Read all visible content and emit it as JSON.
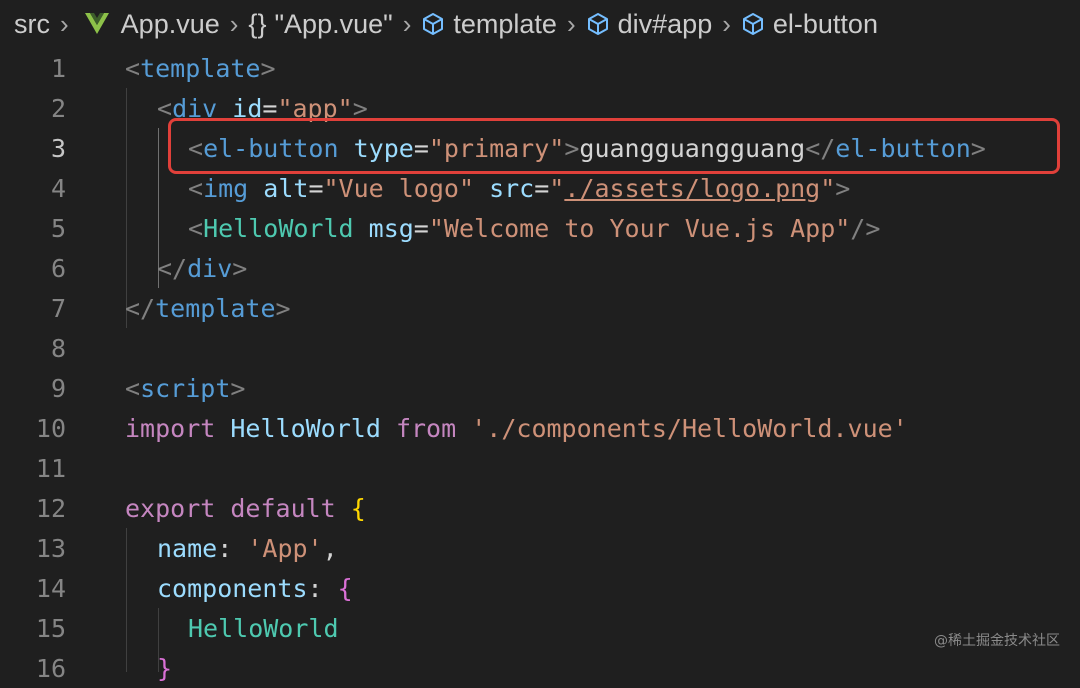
{
  "breadcrumb": {
    "items": [
      "src",
      "App.vue",
      "\"App.vue\"",
      "template",
      "div#app",
      "el-button"
    ],
    "separator": ">",
    "braces": "{}"
  },
  "editor": {
    "line_numbers": [
      "1",
      "2",
      "3",
      "4",
      "5",
      "6",
      "7",
      "8",
      "9",
      "10",
      "11",
      "12",
      "13",
      "14",
      "15",
      "16"
    ],
    "active_line": "3",
    "lines": {
      "l1": {
        "open": "<",
        "tag": "template",
        "close": ">"
      },
      "l2": {
        "open": "<",
        "tag": "div",
        "attr": "id",
        "eq": "=",
        "val": "\"app\"",
        "close": ">"
      },
      "l3": {
        "open": "<",
        "tag": "el-button",
        "attr": "type",
        "eq": "=",
        "val": "\"primary\"",
        "close": ">",
        "text": "guangguangguang",
        "end_open": "</",
        "end_tag": "el-button",
        "end_close": ">"
      },
      "l4": {
        "open": "<",
        "tag": "img",
        "attr1": "alt",
        "eq": "=",
        "val1": "\"Vue logo\"",
        "attr2": "src",
        "q1": "\"",
        "val2": "./assets/logo.png",
        "q2": "\"",
        "close": ">"
      },
      "l5": {
        "open": "<",
        "tag": "HelloWorld",
        "attr": "msg",
        "eq": "=",
        "val": "\"Welcome to Your Vue.js App\"",
        "close": "/>"
      },
      "l6": {
        "open": "</",
        "tag": "div",
        "close": ">"
      },
      "l7": {
        "open": "</",
        "tag": "template",
        "close": ">"
      },
      "l9": {
        "open": "<",
        "tag": "script",
        "close": ">"
      },
      "l10": {
        "kw1": "import",
        "id": "HelloWorld",
        "kw2": "from",
        "str": "'./components/HelloWorld.vue'"
      },
      "l12": {
        "kw1": "export",
        "kw2": "default",
        "brace": "{"
      },
      "l13": {
        "key": "name",
        "colon": ":",
        "str": "'App'",
        "comma": ","
      },
      "l14": {
        "key": "components",
        "colon": ":",
        "brace": "{"
      },
      "l15": {
        "id": "HelloWorld"
      },
      "l16": {
        "brace": "}"
      }
    }
  },
  "watermark": "@稀土掘金技术社区",
  "colors": {
    "background": "#1f1f1f",
    "highlight_border": "#e0403a",
    "vue_green": "#41b883"
  }
}
